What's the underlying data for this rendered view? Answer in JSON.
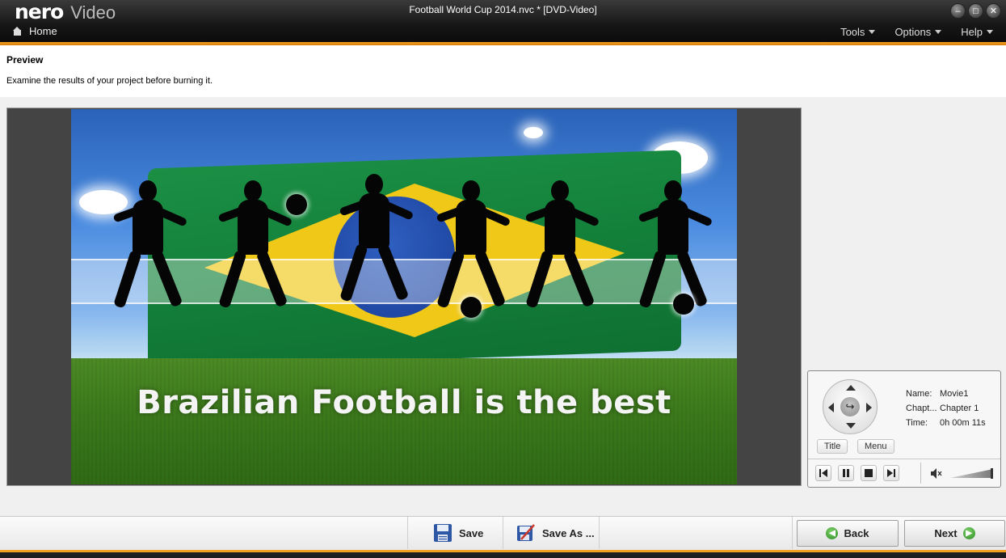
{
  "app": {
    "logo_brand": "nero",
    "logo_product": "Video",
    "window_title": "Football World Cup 2014.nvc * [DVD-Video]",
    "window_buttons": [
      "minimize-icon",
      "maximize-icon",
      "close-icon"
    ]
  },
  "nav": {
    "home_label": "Home",
    "menus": [
      {
        "label": "Tools"
      },
      {
        "label": "Options"
      },
      {
        "label": "Help"
      }
    ]
  },
  "page": {
    "title": "Preview",
    "description": "Examine the results of your project before burning it."
  },
  "video": {
    "caption": "Brazilian Football is the best"
  },
  "player_panel": {
    "info": [
      {
        "key": "Name:",
        "value": "Movie1"
      },
      {
        "key": "Chapt...",
        "value": "Chapter 1"
      },
      {
        "key": "Time:",
        "value": "0h 00m 11s"
      }
    ],
    "title_button": "Title",
    "menu_button": "Menu",
    "transport": [
      "previous-icon",
      "pause-icon",
      "stop-icon",
      "next-icon"
    ],
    "volume_icon": "speaker-icon"
  },
  "bottom": {
    "save_label": "Save",
    "save_as_label": "Save As ...",
    "back_label": "Back",
    "next_label": "Next"
  },
  "colors": {
    "accent": "#f5a323",
    "titlebar": "#151515",
    "go_green": "#2b8a22"
  }
}
